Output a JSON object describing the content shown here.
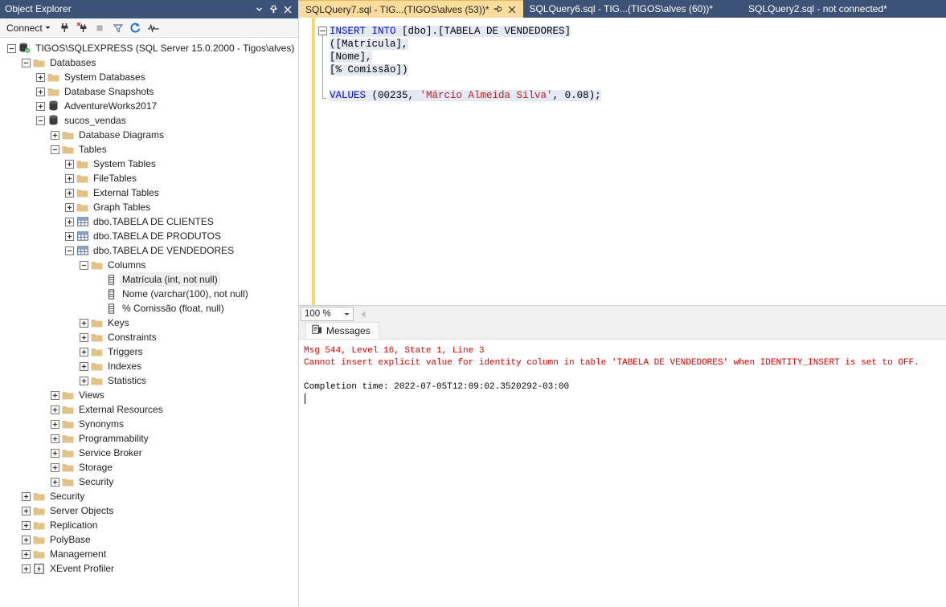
{
  "object_explorer": {
    "title": "Object Explorer",
    "titlebar_buttons": [
      {
        "name": "dropdown",
        "glyph": "chevron-down-icon"
      },
      {
        "name": "pin",
        "glyph": "pin-icon"
      },
      {
        "name": "close",
        "glyph": "close-icon"
      }
    ],
    "toolbar": {
      "connect_label": "Connect",
      "icons": [
        "connect-plug-icon",
        "disconnect-plug-icon",
        "stop-square-icon",
        "filter-funnel-icon",
        "refresh-icon",
        "activity-monitor-icon"
      ]
    },
    "tree": [
      {
        "label": "TIGOS\\SQLEXPRESS (SQL Server 15.0.2000 - Tigos\\alves)",
        "depth": 0,
        "state": "expanded",
        "icon": "server-icon",
        "selected": false
      },
      {
        "label": "Databases",
        "depth": 1,
        "state": "expanded",
        "icon": "folder-icon",
        "selected": false
      },
      {
        "label": "System Databases",
        "depth": 2,
        "state": "collapsed",
        "icon": "folder-icon",
        "selected": false
      },
      {
        "label": "Database Snapshots",
        "depth": 2,
        "state": "collapsed",
        "icon": "folder-icon",
        "selected": false
      },
      {
        "label": "AdventureWorks2017",
        "depth": 2,
        "state": "collapsed",
        "icon": "database-icon",
        "selected": false
      },
      {
        "label": "sucos_vendas",
        "depth": 2,
        "state": "expanded",
        "icon": "database-icon",
        "selected": false
      },
      {
        "label": "Database Diagrams",
        "depth": 3,
        "state": "collapsed",
        "icon": "folder-icon",
        "selected": false
      },
      {
        "label": "Tables",
        "depth": 3,
        "state": "expanded",
        "icon": "folder-icon",
        "selected": false
      },
      {
        "label": "System Tables",
        "depth": 4,
        "state": "collapsed",
        "icon": "folder-icon",
        "selected": false
      },
      {
        "label": "FileTables",
        "depth": 4,
        "state": "collapsed",
        "icon": "folder-icon",
        "selected": false
      },
      {
        "label": "External Tables",
        "depth": 4,
        "state": "collapsed",
        "icon": "folder-icon",
        "selected": false
      },
      {
        "label": "Graph Tables",
        "depth": 4,
        "state": "collapsed",
        "icon": "folder-icon",
        "selected": false
      },
      {
        "label": "dbo.TABELA DE CLIENTES",
        "depth": 4,
        "state": "collapsed",
        "icon": "table-icon",
        "selected": false
      },
      {
        "label": "dbo.TABELA DE PRODUTOS",
        "depth": 4,
        "state": "collapsed",
        "icon": "table-icon",
        "selected": false
      },
      {
        "label": "dbo.TABELA DE VENDEDORES",
        "depth": 4,
        "state": "expanded",
        "icon": "table-icon",
        "selected": false
      },
      {
        "label": "Columns",
        "depth": 5,
        "state": "expanded",
        "icon": "folder-icon",
        "selected": false
      },
      {
        "label": "Matrícula (int, not null)",
        "depth": 6,
        "state": "leaf",
        "icon": "column-icon",
        "selected": true
      },
      {
        "label": "Nome (varchar(100), not null)",
        "depth": 6,
        "state": "leaf",
        "icon": "column-icon",
        "selected": false
      },
      {
        "label": "% Comissão (float, null)",
        "depth": 6,
        "state": "leaf",
        "icon": "column-icon",
        "selected": false
      },
      {
        "label": "Keys",
        "depth": 5,
        "state": "collapsed",
        "icon": "folder-icon",
        "selected": false
      },
      {
        "label": "Constraints",
        "depth": 5,
        "state": "collapsed",
        "icon": "folder-icon",
        "selected": false
      },
      {
        "label": "Triggers",
        "depth": 5,
        "state": "collapsed",
        "icon": "folder-icon",
        "selected": false
      },
      {
        "label": "Indexes",
        "depth": 5,
        "state": "collapsed",
        "icon": "folder-icon",
        "selected": false
      },
      {
        "label": "Statistics",
        "depth": 5,
        "state": "collapsed",
        "icon": "folder-icon",
        "selected": false
      },
      {
        "label": "Views",
        "depth": 3,
        "state": "collapsed",
        "icon": "folder-icon",
        "selected": false
      },
      {
        "label": "External Resources",
        "depth": 3,
        "state": "collapsed",
        "icon": "folder-icon",
        "selected": false
      },
      {
        "label": "Synonyms",
        "depth": 3,
        "state": "collapsed",
        "icon": "folder-icon",
        "selected": false
      },
      {
        "label": "Programmability",
        "depth": 3,
        "state": "collapsed",
        "icon": "folder-icon",
        "selected": false
      },
      {
        "label": "Service Broker",
        "depth": 3,
        "state": "collapsed",
        "icon": "folder-icon",
        "selected": false
      },
      {
        "label": "Storage",
        "depth": 3,
        "state": "collapsed",
        "icon": "folder-icon",
        "selected": false
      },
      {
        "label": "Security",
        "depth": 3,
        "state": "collapsed",
        "icon": "folder-icon",
        "selected": false
      },
      {
        "label": "Security",
        "depth": 1,
        "state": "collapsed",
        "icon": "folder-icon",
        "selected": false
      },
      {
        "label": "Server Objects",
        "depth": 1,
        "state": "collapsed",
        "icon": "folder-icon",
        "selected": false
      },
      {
        "label": "Replication",
        "depth": 1,
        "state": "collapsed",
        "icon": "folder-icon",
        "selected": false
      },
      {
        "label": "PolyBase",
        "depth": 1,
        "state": "collapsed",
        "icon": "folder-icon",
        "selected": false
      },
      {
        "label": "Management",
        "depth": 1,
        "state": "collapsed",
        "icon": "folder-icon",
        "selected": false
      },
      {
        "label": "XEvent Profiler",
        "depth": 1,
        "state": "collapsed",
        "icon": "xevent-icon",
        "selected": false
      }
    ]
  },
  "editor": {
    "tabs": [
      {
        "label": "SQLQuery7.sql - TIG...(TIGOS\\alves (53))*",
        "active": true
      },
      {
        "label": "SQLQuery6.sql - TIG...(TIGOS\\alves (60))*",
        "active": false
      },
      {
        "label": "SQLQuery2.sql - not connected*",
        "active": false
      }
    ],
    "code_lines": [
      {
        "highlighted": true,
        "tokens": [
          {
            "t": "INSERT INTO",
            "c": "kw"
          },
          {
            "t": " [dbo].[TABELA DE VENDEDORES]",
            "c": "num"
          }
        ]
      },
      {
        "highlighted": true,
        "tokens": [
          {
            "t": "([Matrícula],",
            "c": "num"
          }
        ]
      },
      {
        "highlighted": true,
        "tokens": [
          {
            "t": "[Nome],",
            "c": "num"
          }
        ]
      },
      {
        "highlighted": true,
        "tokens": [
          {
            "t": "[% Comissão])",
            "c": "num"
          }
        ]
      },
      {
        "highlighted": false,
        "tokens": [
          {
            "t": "",
            "c": "num"
          }
        ]
      },
      {
        "highlighted": true,
        "tokens": [
          {
            "t": "VALUES",
            "c": "kw"
          },
          {
            "t": " (00235, ",
            "c": "num"
          },
          {
            "t": "'Márcio Almeida Silva'",
            "c": "str"
          },
          {
            "t": ", 0.08);",
            "c": "num"
          }
        ]
      }
    ],
    "zoom_level": "100 %"
  },
  "results": {
    "tab_label": "Messages",
    "tab_icon": "messages-icon",
    "lines": [
      {
        "text": "Msg 544, Level 16, State 1, Line 3",
        "kind": "error"
      },
      {
        "text": "Cannot insert explicit value for identity column in table 'TABELA DE VENDEDORES' when IDENTITY_INSERT is set to OFF.",
        "kind": "error"
      },
      {
        "text": "",
        "kind": "blank"
      },
      {
        "text": "Completion time: 2022-07-05T12:09:02.3520292-03:00",
        "kind": "normal"
      }
    ]
  },
  "colors": {
    "titlebar": "#3d5277",
    "active_tab": "#fcdc9d",
    "keyword": "#0000ff",
    "string": "#bb2222",
    "error_text": "#dd0000",
    "selection": "#e4e9f2",
    "change_bar": "#f2da6d",
    "folder": "#dcb67a"
  }
}
